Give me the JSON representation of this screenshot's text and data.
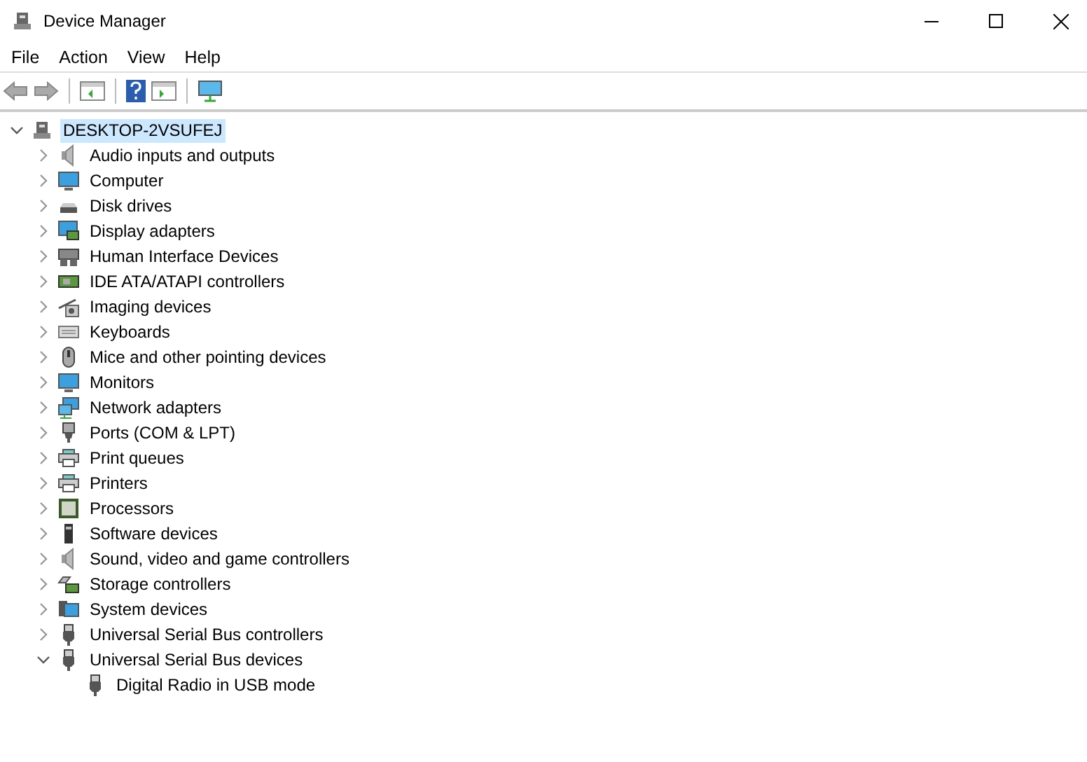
{
  "window": {
    "title": "Device Manager"
  },
  "menu": [
    "File",
    "Action",
    "View",
    "Help"
  ],
  "tree": [
    {
      "label": "DESKTOP-2VSUFEJ",
      "selected": true,
      "expanded": true,
      "children": [
        {
          "label": "Audio inputs and outputs",
          "selected": false,
          "expanded": false
        },
        {
          "label": "Computer",
          "selected": false,
          "expanded": false
        },
        {
          "label": "Disk drives",
          "selected": false,
          "expanded": false
        },
        {
          "label": "Display adapters",
          "selected": false,
          "expanded": false
        },
        {
          "label": "Human Interface Devices",
          "selected": false,
          "expanded": false
        },
        {
          "label": "IDE ATA/ATAPI controllers",
          "selected": false,
          "expanded": false
        },
        {
          "label": "Imaging devices",
          "selected": false,
          "expanded": false
        },
        {
          "label": "Keyboards",
          "selected": false,
          "expanded": false
        },
        {
          "label": "Mice and other pointing devices",
          "selected": false,
          "expanded": false
        },
        {
          "label": "Monitors",
          "selected": false,
          "expanded": false
        },
        {
          "label": "Network adapters",
          "selected": false,
          "expanded": false
        },
        {
          "label": "Ports (COM & LPT)",
          "selected": false,
          "expanded": false
        },
        {
          "label": "Print queues",
          "selected": false,
          "expanded": false
        },
        {
          "label": "Printers",
          "selected": false,
          "expanded": false
        },
        {
          "label": "Processors",
          "selected": false,
          "expanded": false
        },
        {
          "label": "Software devices",
          "selected": false,
          "expanded": false
        },
        {
          "label": "Sound, video and game controllers",
          "selected": false,
          "expanded": false
        },
        {
          "label": "Storage controllers",
          "selected": false,
          "expanded": false
        },
        {
          "label": "System devices",
          "selected": false,
          "expanded": false
        },
        {
          "label": "Universal Serial Bus controllers",
          "selected": false,
          "expanded": false
        },
        {
          "label": "Universal Serial Bus devices",
          "selected": false,
          "expanded": true,
          "children": [
            {
              "label": "Digital Radio in USB mode",
              "selected": false
            }
          ]
        }
      ]
    }
  ]
}
